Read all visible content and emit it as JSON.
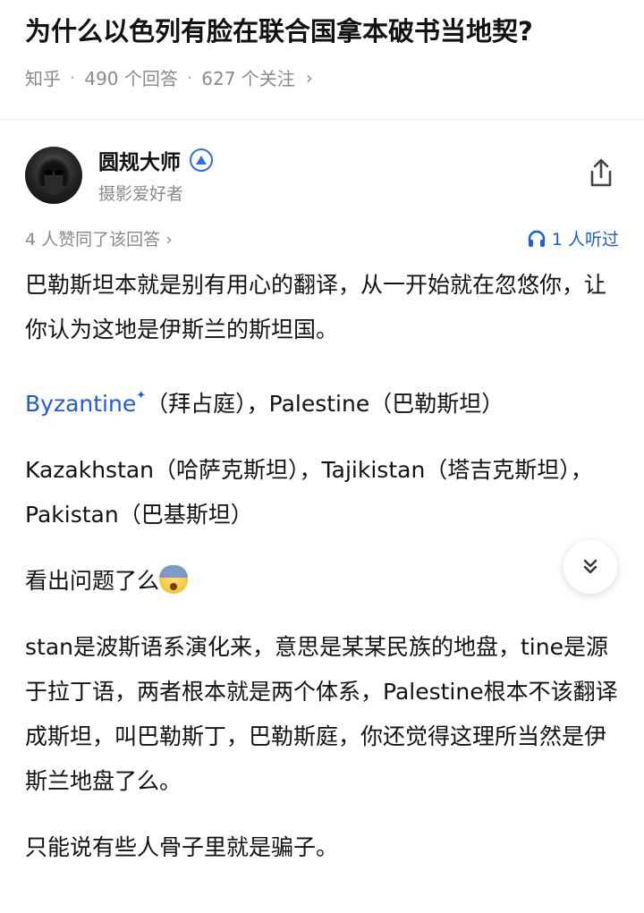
{
  "question": {
    "title": "为什么以色列有脸在联合国拿本破书当地契?",
    "source": "知乎",
    "answers": "490 个回答",
    "followers": "627 个关注"
  },
  "author": {
    "name": "圆规大师",
    "bio": "摄影爱好者",
    "badge_icon": "verified-badge-icon"
  },
  "stats": {
    "likes": "4 人赞同了该回答",
    "listened": "1 人听过"
  },
  "content": {
    "p1": "巴勒斯坦本就是别有用心的翻译，从一开始就在忽悠你，让你认为这地是伊斯兰的斯坦国。",
    "p2_link": "Byzantine",
    "p2_rest": "（拜占庭），Palestine（巴勒斯坦）",
    "p3": "Kazakhstan（哈萨克斯坦），Tajikistan（塔吉克斯坦），Pakistan（巴基斯坦）",
    "p4": "看出问题了么",
    "p5": "stan是波斯语系演化来，意思是某某民族的地盘，tine是源于拉丁语，两者根本就是两个体系，Palestine根本不该翻译成斯坦，叫巴勒斯丁，巴勒斯庭，你还觉得这理所当然是伊斯兰地盘了么。",
    "p6": "只能说有些人骨子里就是骗子。"
  },
  "colors": {
    "link": "#1f5bd6",
    "meta": "#8a8a8a"
  }
}
